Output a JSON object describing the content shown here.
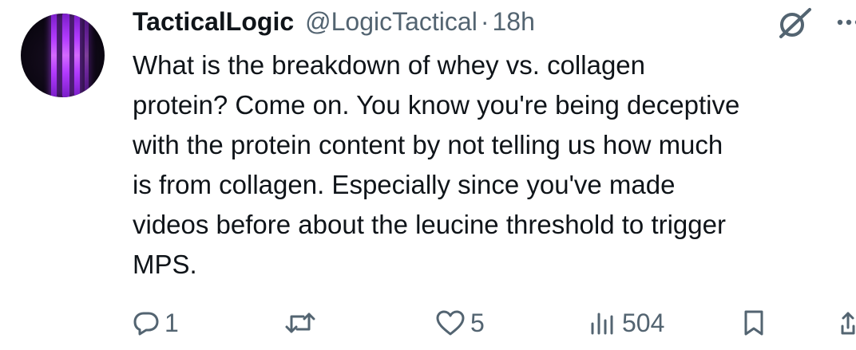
{
  "tweet": {
    "author": {
      "display_name": "TacticalLogic",
      "handle": "@LogicTactical",
      "separator": "·",
      "time": "18h"
    },
    "text": "What is the breakdown of whey vs. collagen\nprotein? Come on. You know you're being deceptive\nwith the protein content by not telling us how much\nis from collagen. Especially since you've made\nvideos before about the leucine threshold to trigger\nMPS.",
    "actions": {
      "replies": "1",
      "reposts": "",
      "likes": "5",
      "views": "504"
    }
  },
  "icons": {
    "grok": "grok-icon",
    "more": "more-icon",
    "reply": "reply-icon",
    "repost": "repost-icon",
    "like": "heart-icon",
    "views": "views-bar-chart-icon",
    "bookmark": "bookmark-icon",
    "share": "share-icon"
  },
  "colors": {
    "text_primary": "#0f1419",
    "text_secondary": "#536471",
    "background": "#ffffff",
    "avatar_accent": "#b33cff"
  }
}
